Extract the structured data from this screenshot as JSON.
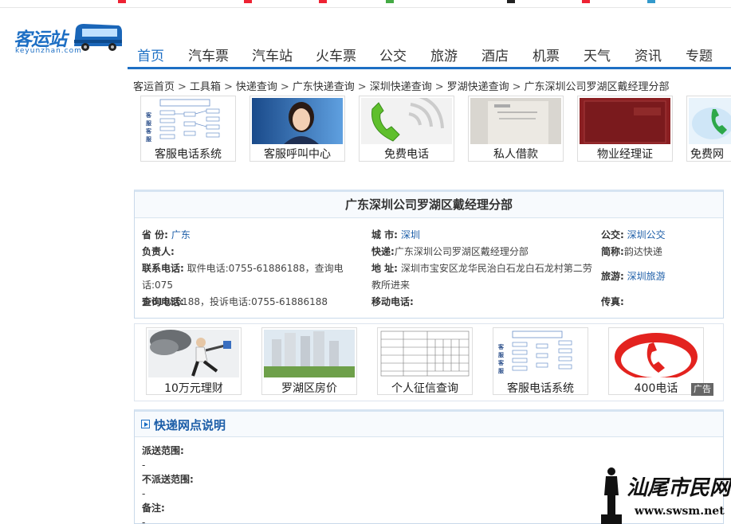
{
  "site": {
    "logo_text": "客运站",
    "logo_sub": "keyunzhan.com",
    "brand_color": "#1d6fc4"
  },
  "nav": {
    "items": [
      "首页",
      "汽车票",
      "汽车站",
      "火车票",
      "公交",
      "旅游",
      "酒店",
      "机票",
      "天气",
      "资讯",
      "专题"
    ],
    "active_index": 0
  },
  "breadcrumb": [
    "客运首页",
    "工具箱",
    "快递查询",
    "广东快递查询",
    "深圳快递查询",
    "罗湖快递查询",
    "广东深圳公司罗湖区戴经理分部"
  ],
  "ads_top": [
    {
      "label": "客服电话系统",
      "icon": "flowchart-thumb"
    },
    {
      "label": "客服呼叫中心",
      "icon": "operator-photo"
    },
    {
      "label": "免费电话",
      "icon": "phone-handset-green"
    },
    {
      "label": "私人借款",
      "icon": "document-photo"
    },
    {
      "label": "物业经理证",
      "icon": "certificate-photo"
    },
    {
      "label": "免费网",
      "icon": "cloud-phone"
    }
  ],
  "info": {
    "title": "广东深圳公司罗湖区戴经理分部",
    "province_label": "省 份:",
    "province_value": "广东",
    "city_label": "城 市:",
    "city_value": "深圳",
    "bus_label": "公交:",
    "bus_value": "深圳公交",
    "manager_label": "负责人:",
    "manager_value": "",
    "express_label": "快递:",
    "express_value": "广东深圳公司罗湖区戴经理分部",
    "short_label": "简称:",
    "short_value": "韵达快递",
    "phone_label": "联系电话:",
    "phone_value_1": "取件电话:0755-61886188，查询电话:075",
    "phone_value_2": "5-61886188，投诉电话:0755-61886188",
    "address_label": "地 址:",
    "address_value_1": "深圳市宝安区龙华民治白石龙白石龙村第二劳",
    "address_value_2": "教所进来",
    "travel_label": "旅游:",
    "travel_value": "深圳旅游",
    "query_phone_label": "查询电话:",
    "query_phone_value": "",
    "mobile_label": "移动电话:",
    "mobile_value": "",
    "fax_label": "传真:",
    "fax_value": ""
  },
  "ads_mid": [
    {
      "label": "10万元理财",
      "icon": "businessman-photo"
    },
    {
      "label": "罗湖区房价",
      "icon": "buildings-photo"
    },
    {
      "label": "个人征信查询",
      "icon": "form-thumb"
    },
    {
      "label": "客服电话系统",
      "icon": "flowchart-thumb"
    },
    {
      "label": "400电话",
      "icon": "red-phone-icon"
    }
  ],
  "ad_badge": "广告",
  "notes": {
    "title": "快递网点说明",
    "delivery_range_label": "派送范围:",
    "delivery_range_value": "-",
    "no_delivery_label": "不派送范围:",
    "no_delivery_value": "-",
    "remark_label": "备注:",
    "remark_value": "-"
  },
  "watermark": {
    "text": "汕尾市民网",
    "url": "www.swsm.net"
  }
}
